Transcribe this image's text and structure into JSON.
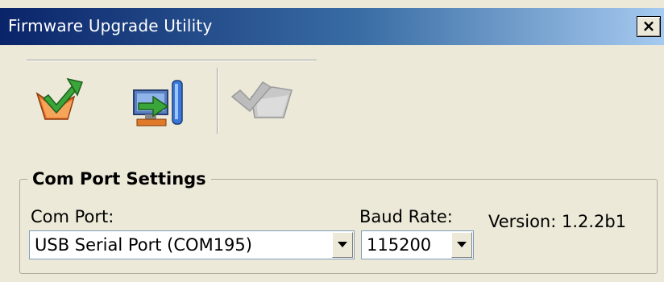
{
  "window": {
    "title": "Firmware Upgrade Utility",
    "close_label": "×"
  },
  "toolbar": {
    "buttons": [
      {
        "icon": "open-folder-arrow-icon",
        "enabled": true
      },
      {
        "icon": "upload-to-device-icon",
        "enabled": true
      },
      {
        "icon": "open-folder-arrow-disabled-icon",
        "enabled": false
      }
    ]
  },
  "settings": {
    "group_title": "Com Port Settings",
    "com_port_label": "Com Port:",
    "com_port_value": "USB Serial Port (COM195)",
    "baud_rate_label": "Baud Rate:",
    "baud_rate_value": "115200",
    "version_text": "Version: 1.2.2b1"
  }
}
